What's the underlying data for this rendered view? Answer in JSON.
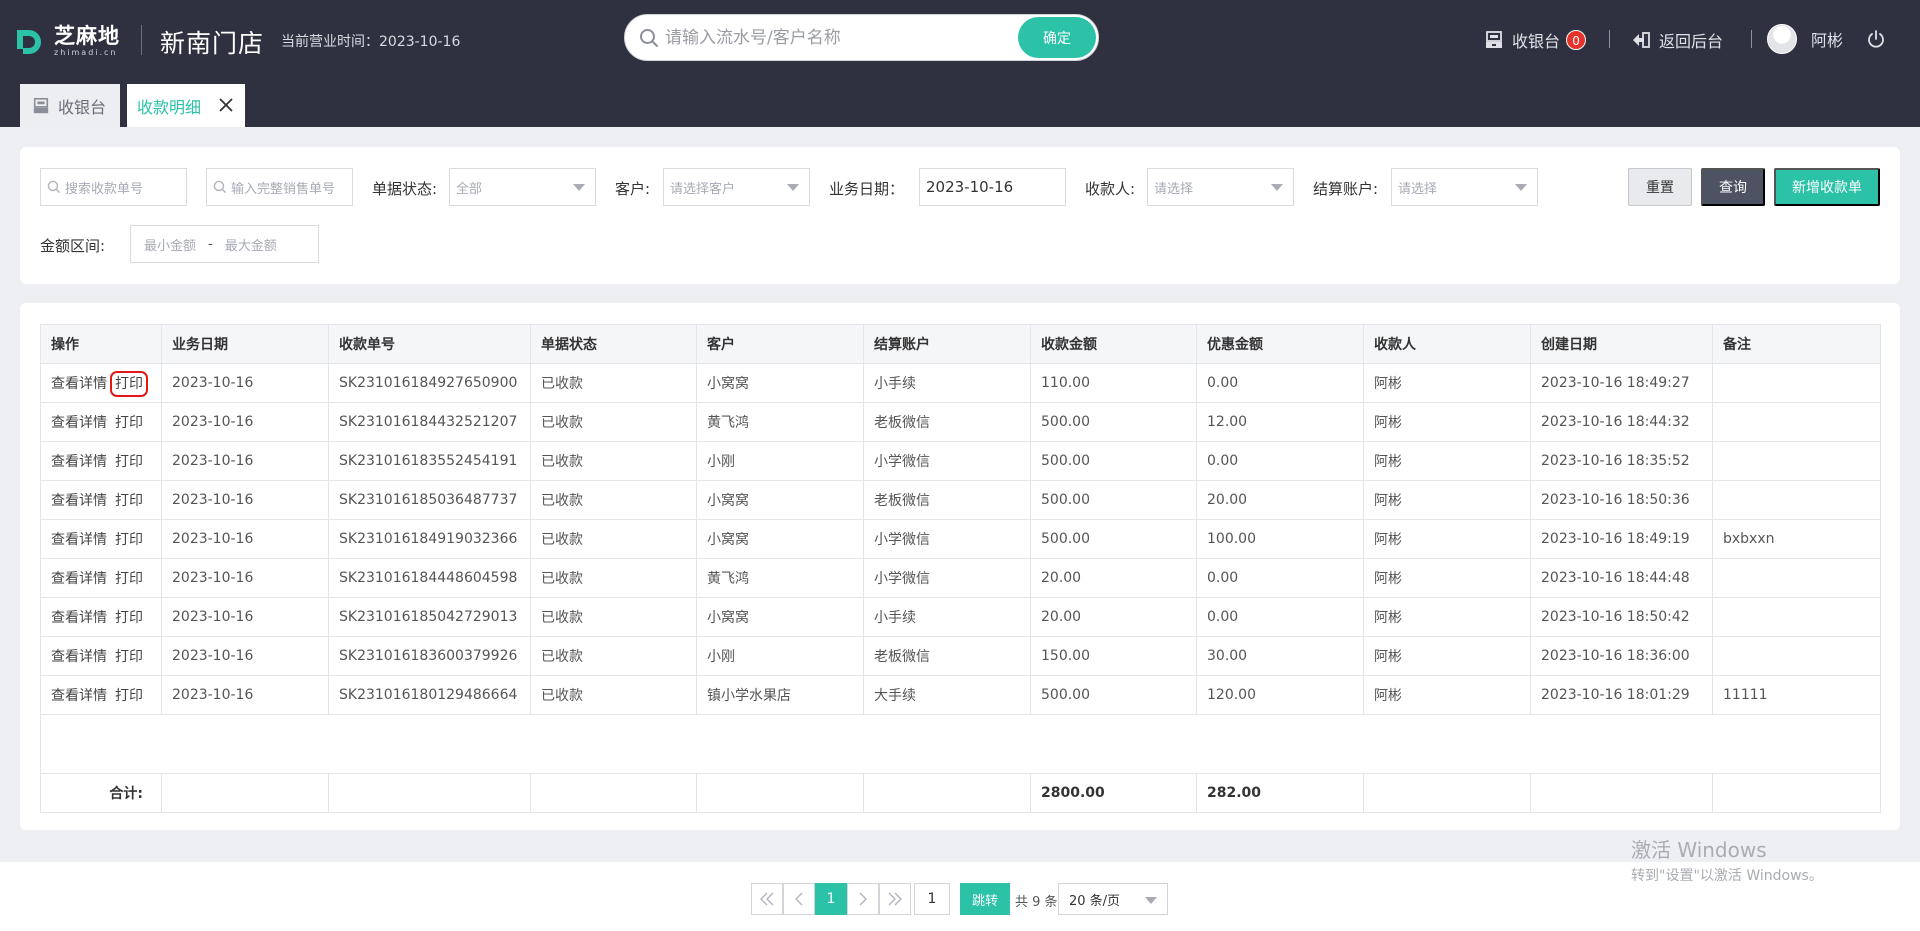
{
  "header": {
    "logo_cn": "芝麻地",
    "logo_en": "zhimadi.cn",
    "store_name": "新南门店",
    "biz_time_label": "当前营业时间：2023-10-16",
    "search_placeholder": "请输入流水号/客户名称",
    "search_confirm": "确定",
    "cashier_label": "收银台",
    "cashier_badge": "0",
    "back_label": "返回后台",
    "user_name": "阿彬"
  },
  "tabs": [
    {
      "label": "收银台"
    },
    {
      "label": "收款明细"
    }
  ],
  "filters": {
    "receipt_no_placeholder": "搜索收款单号",
    "sales_no_placeholder": "输入完整销售单号",
    "status_label": "单据状态:",
    "status_value": "全部",
    "customer_label": "客户:",
    "customer_placeholder": "请选择客户",
    "date_label": "业务日期：",
    "date_value": "2023-10-16",
    "payee_label": "收款人:",
    "payee_placeholder": "请选择",
    "account_label": "结算账户:",
    "account_placeholder": "请选择",
    "amount_label": "金额区间:",
    "min_placeholder": "最小金额",
    "range_sep": "-",
    "max_placeholder": "最大金额",
    "reset": "重置",
    "query": "查询",
    "add": "新增收款单"
  },
  "table": {
    "columns": [
      "操作",
      "业务日期",
      "收款单号",
      "单据状态",
      "客户",
      "结算账户",
      "收款金额",
      "优惠金额",
      "收款人",
      "创建日期",
      "备注"
    ],
    "op_detail": "查看详情",
    "op_print": "打印",
    "rows": [
      {
        "date": "2023-10-16",
        "no": "SK231016184927650900",
        "status": "已收款",
        "customer": "小窝窝",
        "account": "小手续",
        "amount": "110.00",
        "discount": "0.00",
        "payee": "阿彬",
        "created": "2023-10-16 18:49:27",
        "note": ""
      },
      {
        "date": "2023-10-16",
        "no": "SK231016184432521207",
        "status": "已收款",
        "customer": "黄飞鸿",
        "account": "老板微信",
        "amount": "500.00",
        "discount": "12.00",
        "payee": "阿彬",
        "created": "2023-10-16 18:44:32",
        "note": ""
      },
      {
        "date": "2023-10-16",
        "no": "SK231016183552454191",
        "status": "已收款",
        "customer": "小刚",
        "account": "小学微信",
        "amount": "500.00",
        "discount": "0.00",
        "payee": "阿彬",
        "created": "2023-10-16 18:35:52",
        "note": ""
      },
      {
        "date": "2023-10-16",
        "no": "SK231016185036487737",
        "status": "已收款",
        "customer": "小窝窝",
        "account": "老板微信",
        "amount": "500.00",
        "discount": "20.00",
        "payee": "阿彬",
        "created": "2023-10-16 18:50:36",
        "note": ""
      },
      {
        "date": "2023-10-16",
        "no": "SK231016184919032366",
        "status": "已收款",
        "customer": "小窝窝",
        "account": "小学微信",
        "amount": "500.00",
        "discount": "100.00",
        "payee": "阿彬",
        "created": "2023-10-16 18:49:19",
        "note": "bxbxxn"
      },
      {
        "date": "2023-10-16",
        "no": "SK231016184448604598",
        "status": "已收款",
        "customer": "黄飞鸿",
        "account": "小学微信",
        "amount": "20.00",
        "discount": "0.00",
        "payee": "阿彬",
        "created": "2023-10-16 18:44:48",
        "note": ""
      },
      {
        "date": "2023-10-16",
        "no": "SK231016185042729013",
        "status": "已收款",
        "customer": "小窝窝",
        "account": "小手续",
        "amount": "20.00",
        "discount": "0.00",
        "payee": "阿彬",
        "created": "2023-10-16 18:50:42",
        "note": ""
      },
      {
        "date": "2023-10-16",
        "no": "SK231016183600379926",
        "status": "已收款",
        "customer": "小刚",
        "account": "老板微信",
        "amount": "150.00",
        "discount": "30.00",
        "payee": "阿彬",
        "created": "2023-10-16 18:36:00",
        "note": ""
      },
      {
        "date": "2023-10-16",
        "no": "SK231016180129486664",
        "status": "已收款",
        "customer": "镇小学水果店",
        "account": "大手续",
        "amount": "500.00",
        "discount": "120.00",
        "payee": "阿彬",
        "created": "2023-10-16 18:01:29",
        "note": "11111"
      }
    ],
    "total_label": "合计:",
    "total_amount": "2800.00",
    "total_discount": "282.00"
  },
  "pagination": {
    "current_page": "1",
    "jump_value": "1",
    "jump_label": "跳转",
    "total_text": "共 9 条",
    "page_size": "20 条/页"
  },
  "watermark": {
    "line1": "激活 Windows",
    "line2": "转到\"设置\"以激活 Windows。"
  },
  "colors": {
    "accent": "#2bc2a8",
    "topbar": "#2f3140",
    "badge": "#e8322c",
    "highlight": "#e01818"
  }
}
